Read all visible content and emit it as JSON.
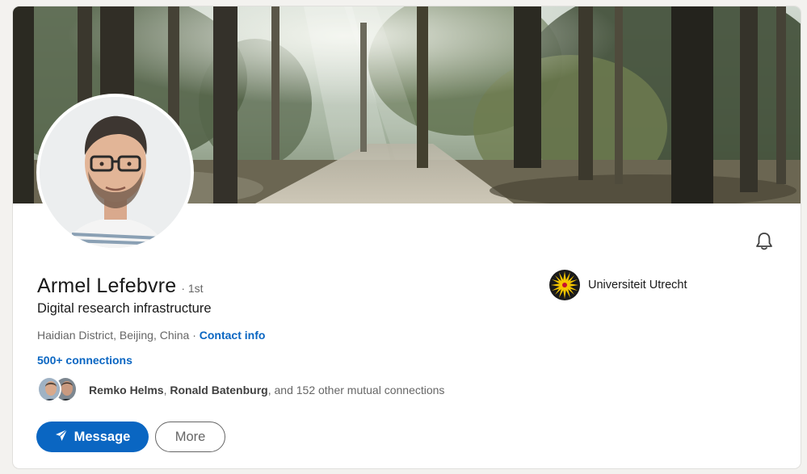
{
  "profile": {
    "name": "Armel Lefebvre",
    "degree": "· 1st",
    "headline": "Digital research infrastructure",
    "location": "Haidian District, Beijing, China",
    "location_sep": " · ",
    "contact_info": "Contact info",
    "connections": "500+ connections"
  },
  "mutual": {
    "name1": "Remko Helms",
    "name2": "Ronald Batenburg",
    "rest": ", and 152 other mutual connections"
  },
  "experience": {
    "university": "Universiteit Utrecht"
  },
  "actions": {
    "message": "Message",
    "more": "More"
  },
  "icons": {
    "bell": "bell-icon",
    "send": "paper-plane-icon"
  },
  "colors": {
    "accent": "#0a66c2",
    "secondary_text": "#666666",
    "primary_text": "#191919",
    "uni_gold": "#f6c600"
  }
}
